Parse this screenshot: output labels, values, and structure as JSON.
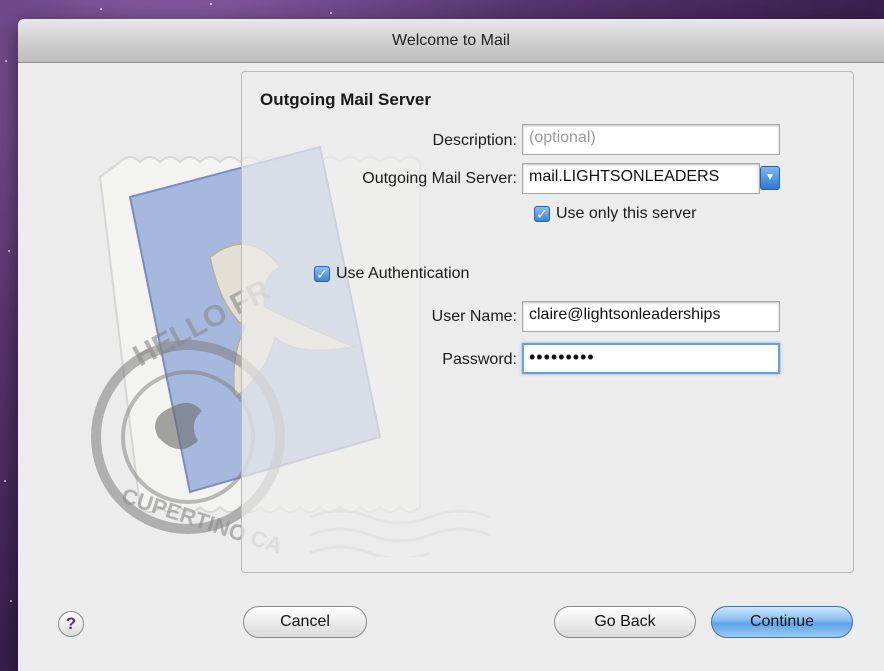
{
  "window": {
    "title": "Welcome to Mail"
  },
  "panel": {
    "heading": "Outgoing Mail Server",
    "description": {
      "label": "Description:",
      "value": "",
      "placeholder": "(optional)"
    },
    "server": {
      "label": "Outgoing Mail Server:",
      "value": "mail.LIGHTSONLEADERS"
    },
    "only_server": {
      "label": "Use only this server",
      "checked": true
    },
    "use_auth": {
      "label": "Use Authentication",
      "checked": true
    },
    "username": {
      "label": "User Name:",
      "value": "claire@lightsonleaderships"
    },
    "password": {
      "label": "Password:",
      "value": "•••••••••"
    }
  },
  "stamp": {
    "top_text": "HELLO FR",
    "bottom_text": "CUPERTINO CA"
  },
  "buttons": {
    "help": "?",
    "cancel": "Cancel",
    "go_back": "Go Back",
    "continue": "Continue"
  },
  "icons": {
    "help": "question-mark-icon",
    "dropdown": "chevron-down-icon",
    "checkbox": "checkmark-icon"
  },
  "colors": {
    "accent": "#3b86dc",
    "focus_ring": "#6b9fd8"
  }
}
